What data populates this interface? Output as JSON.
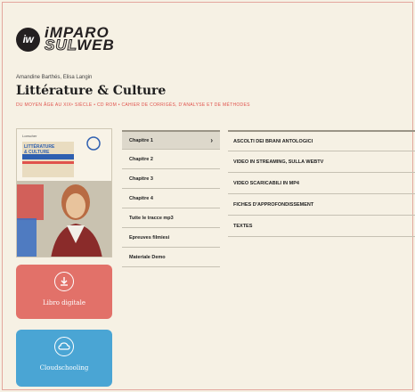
{
  "brand": {
    "badge": "iw",
    "line1": "iMPARO",
    "line2a": "SUL",
    "line2b": "WEB"
  },
  "book": {
    "authors": "Amandine Barthés, Elisa Langin",
    "title": "Littérature & Culture",
    "subtitle": "DU MOYEN ÂGE AU XIXᵉ SIÈCLE • CD ROM • CAHIER DE CORRIGÉS, D'ANALYSE ET DE MÉTHODES"
  },
  "cover": {
    "series_label": "Loescher",
    "title_line1": "LITTÉRATURE",
    "title_line2": "& CULTURE"
  },
  "chapters": [
    {
      "label": "Chapitre 1",
      "active": true
    },
    {
      "label": "Chapitre 2"
    },
    {
      "label": "Chapitre 3"
    },
    {
      "label": "Chapitre 4"
    },
    {
      "label": "Tutte le tracce mp3"
    },
    {
      "label": "Epreuves filmiesi"
    },
    {
      "label": "Materiale Demo"
    }
  ],
  "chevron": "›",
  "resources": [
    {
      "label": "ASCOLTI DEI BRANI ANTOLOGICI"
    },
    {
      "label": "VIDEO IN STREAMING, SULLA WEBTV"
    },
    {
      "label": "VIDEO SCARICABILI IN MP4"
    },
    {
      "label": "FICHES D'APPROFONDISSEMENT"
    },
    {
      "label": "TEXTES"
    }
  ],
  "tiles": {
    "digitale": {
      "label": "Libro digitale",
      "icon": "download-icon",
      "color": "#e27169"
    },
    "cloud": {
      "label": "Cloudschooling",
      "icon": "cloud-icon",
      "color": "#4aa5d4"
    }
  },
  "colors": {
    "accent": "#e0524c",
    "background": "#f6f1e4"
  }
}
